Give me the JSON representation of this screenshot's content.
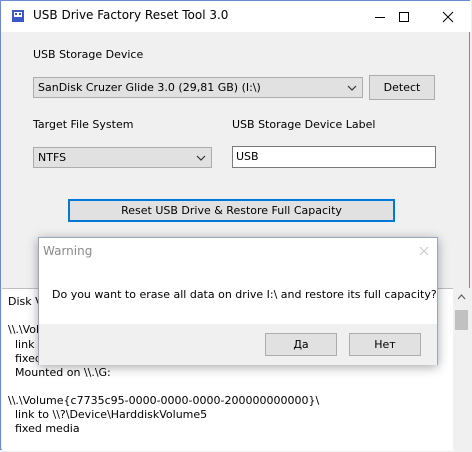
{
  "window": {
    "title": "USB Drive Factory Reset Tool 3.0",
    "accent": "#6b8bd1"
  },
  "device": {
    "label": "USB Storage Device",
    "selected": "SanDisk Cruzer Glide 3.0 (29,81 GB) (I:\\)",
    "detect_label": "Detect"
  },
  "filesystem": {
    "label": "Target File System",
    "selected": "NTFS"
  },
  "volume_label": {
    "label": "USB Storage Device Label",
    "value": "USB"
  },
  "reset_button": "Reset USB Drive & Restore Full Capacity",
  "log": {
    "lines": [
      "Disk Vo",
      "\\\\.\\Volume",
      "link to",
      "fixed",
      "Mounted on \\\\.\\G:",
      "",
      "\\\\.\\Volume{c7735c95-0000-0000-0000-200000000000}\\",
      "link to \\\\?\\Device\\HarddiskVolume5",
      "fixed media"
    ]
  },
  "dialog": {
    "title": "Warning",
    "message": "Do you want to erase all data on drive I:\\ and restore its full capacity?",
    "yes_label": "Да",
    "no_label": "Нет"
  }
}
